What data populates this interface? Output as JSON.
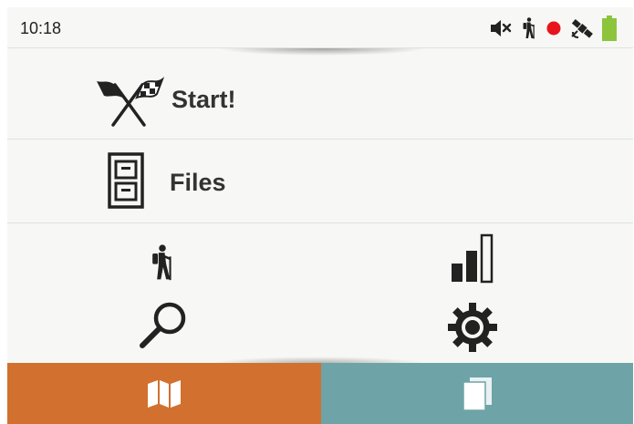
{
  "status_bar": {
    "time": "10:18",
    "icons": [
      "mute-icon",
      "hiker-icon",
      "record-dot-icon",
      "satellite-icon",
      "battery-icon"
    ],
    "record_color": "#e8141c",
    "battery_color": "#8cc43c"
  },
  "menu": {
    "start_label": "Start!",
    "start_icon": "checkered-flags-icon",
    "files_label": "Files",
    "files_icon": "file-cabinet-icon"
  },
  "grid": {
    "icons": [
      "hiker-icon",
      "signal-bars-icon",
      "search-icon",
      "gear-icon"
    ]
  },
  "bottom_nav": {
    "map_color": "#d2702f",
    "pages_color": "#6ea4a7",
    "map_icon": "map-icon",
    "pages_icon": "pages-icon"
  }
}
